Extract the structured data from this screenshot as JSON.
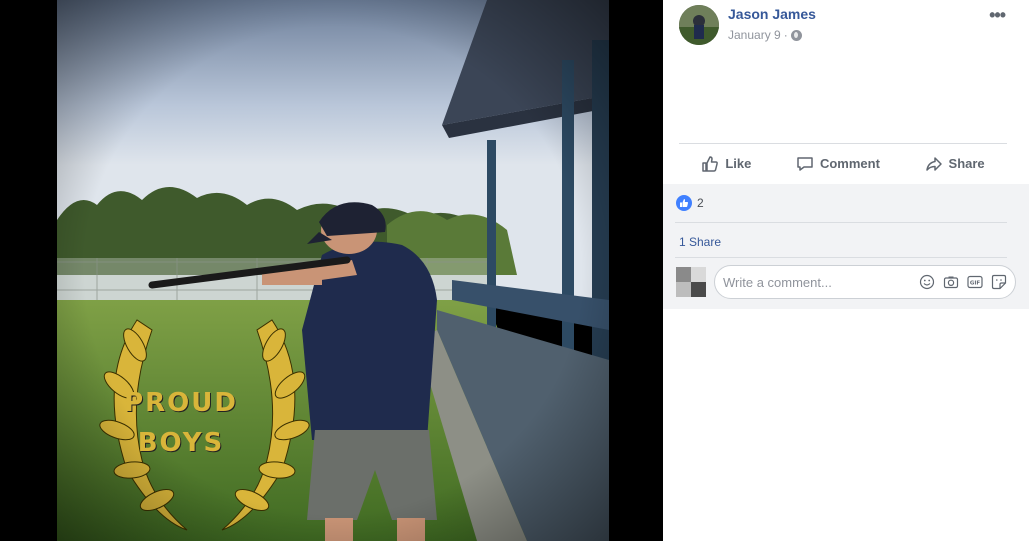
{
  "post": {
    "author_name": "Jason James",
    "date": "January 9",
    "date_separator": "·",
    "privacy_icon": "globe-icon",
    "more_label": "•••"
  },
  "photo": {
    "overlay_text_line1": "PROUD",
    "overlay_text_line2": "BOYS",
    "overlay_color": "#d9b53a"
  },
  "actions": {
    "like_label": "Like",
    "comment_label": "Comment",
    "share_label": "Share"
  },
  "feedback": {
    "reaction_count": "2",
    "shares_text": "1 Share"
  },
  "comment_box": {
    "placeholder": "Write a comment...",
    "icons": [
      "emoji-icon",
      "camera-icon",
      "gif-icon",
      "sticker-icon"
    ]
  },
  "colors": {
    "link_blue": "#365899",
    "like_blue": "#4080ff",
    "action_gray": "#606770",
    "feedback_bg": "#f2f3f5"
  }
}
